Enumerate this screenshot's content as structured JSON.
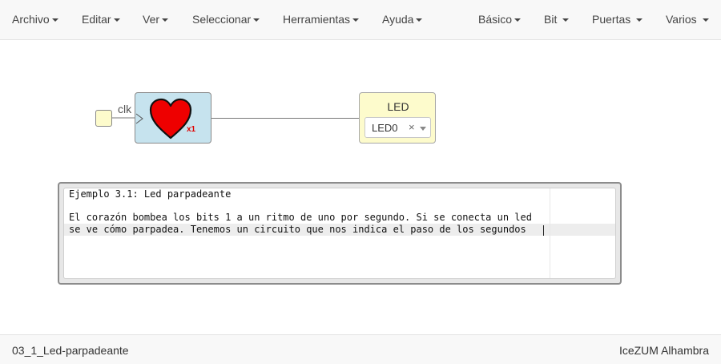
{
  "menubar": {
    "left": [
      {
        "label": "Archivo"
      },
      {
        "label": "Editar"
      },
      {
        "label": "Ver"
      },
      {
        "label": "Seleccionar"
      },
      {
        "label": "Herramientas"
      },
      {
        "label": "Ayuda"
      }
    ],
    "right": [
      {
        "label": "Básico"
      },
      {
        "label": "Bit"
      },
      {
        "label": "Puertas"
      },
      {
        "label": "Varios"
      }
    ]
  },
  "canvas": {
    "clk_label": "clk",
    "heart_block": {
      "icon": "heart-icon",
      "multiplier": "x1",
      "color": "#e00000"
    },
    "led_block": {
      "title": "LED",
      "selected": "LED0",
      "clear": "×"
    }
  },
  "comment": {
    "lines": [
      "Ejemplo 3.1: Led parpadeante",
      "",
      "El corazón bombea los bits 1 a un ritmo de uno por segundo. Si se conecta un led",
      "se ve cómo parpadea. Tenemos un circuito que nos indica el paso de los segundos"
    ]
  },
  "statusbar": {
    "project": "03_1_Led-parpadeante",
    "board": "IceZUM Alhambra"
  }
}
